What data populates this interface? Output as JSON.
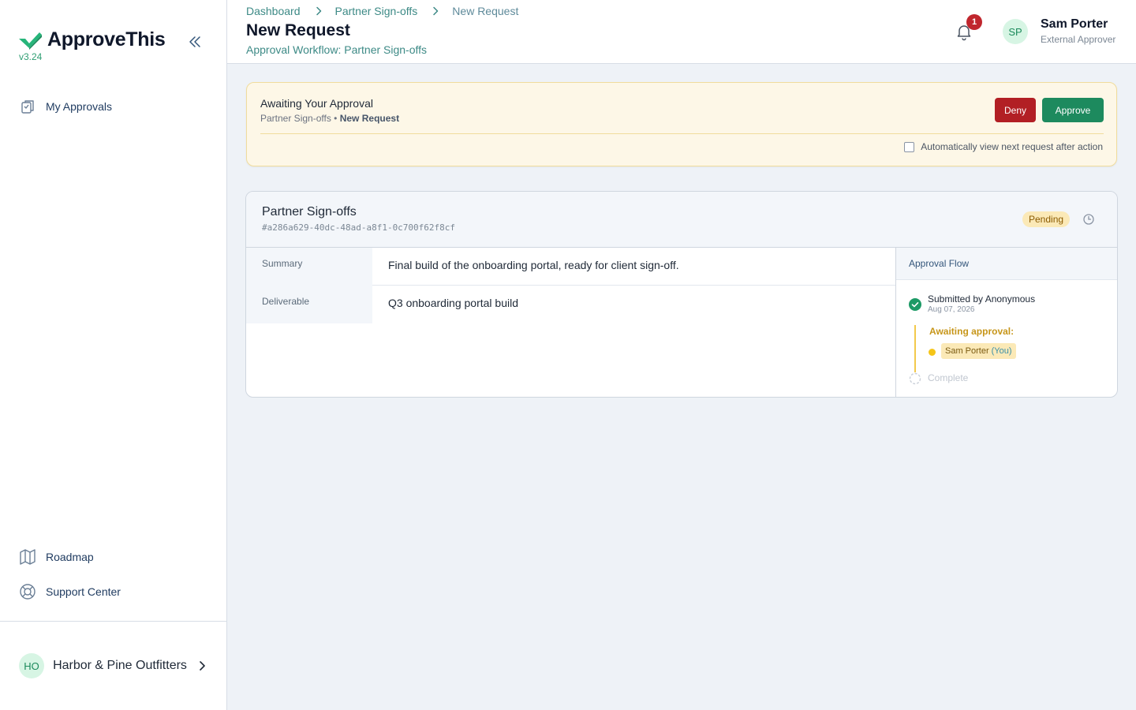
{
  "app": {
    "name": "ApproveThis",
    "version": "v3.24"
  },
  "colors": {
    "brand_green": "#1d8a5e",
    "deny_red": "#b21f24",
    "pending_yellow": "#fbe9b7",
    "link_teal": "#3d8a86"
  },
  "sidebar": {
    "collapse_icon": "chevrons-left-icon",
    "top_items": [
      {
        "label": "My Approvals",
        "icon": "clipboard-icon"
      }
    ],
    "bottom_items": [
      {
        "label": "Roadmap",
        "icon": "map-icon"
      },
      {
        "label": "Support Center",
        "icon": "lifebuoy-icon"
      }
    ],
    "org": {
      "initials": "HO",
      "name": "Harbor & Pine Outfitters",
      "icon": "chevron-right-icon"
    }
  },
  "header": {
    "breadcrumb": [
      "Dashboard",
      "Partner Sign-offs",
      "New Request"
    ],
    "title": "New Request",
    "subtitle": "Approval Workflow: Partner Sign-offs",
    "notifications": {
      "count": "1",
      "icon": "bell-icon"
    },
    "user": {
      "initials": "SP",
      "name": "Sam Porter",
      "role": "External Approver"
    }
  },
  "approval_banner": {
    "title": "Awaiting Your Approval",
    "workflow": "Partner Sign-offs",
    "separator": "•",
    "request": "New Request",
    "deny_label": "Deny",
    "approve_label": "Approve",
    "auto_next_label": "Automatically view next request after action",
    "auto_next_checked": false
  },
  "request": {
    "title": "Partner Sign-offs",
    "id": "#a286a629-40dc-48ad-a8f1-0c700f62f8cf",
    "status": "Pending",
    "history_icon": "clock-icon",
    "fields": [
      {
        "label": "Summary",
        "value": "Final build of the onboarding portal, ready for client sign-off."
      },
      {
        "label": "Deliverable",
        "value": "Q3 onboarding portal build"
      }
    ],
    "flow": {
      "title": "Approval Flow",
      "submitted": "Submitted by Anonymous",
      "submitted_date": "Aug 07, 2026",
      "awaiting_label": "Awaiting approval:",
      "approver": "Sam Porter",
      "approver_suffix": "(You)",
      "complete_label": "Complete"
    }
  }
}
